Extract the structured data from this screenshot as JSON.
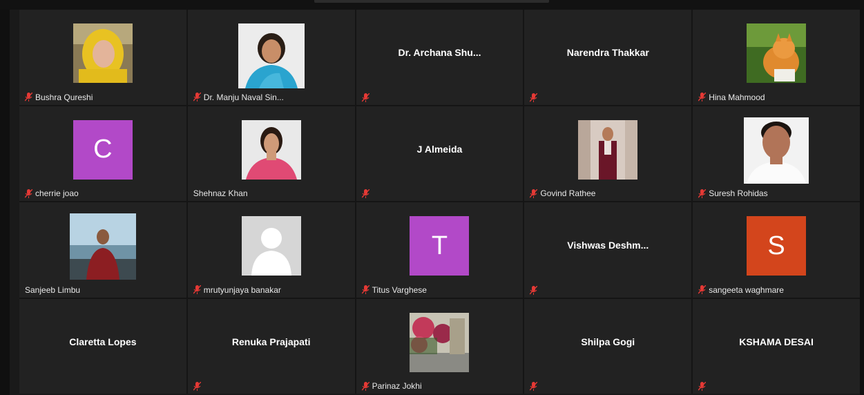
{
  "colors": {
    "background": "#1a1a1a",
    "tile": "#222222",
    "name_text": "#e9e9e9",
    "muted_icon": "#e53935",
    "avatar_purple": "#b249c8",
    "avatar_orange": "#d3451c"
  },
  "participants": [
    {
      "name": "Bushra Qureshi",
      "muted": true,
      "display": "photo"
    },
    {
      "name": "Dr. Manju Naval Sin...",
      "muted": true,
      "display": "photo"
    },
    {
      "name": "Dr. Archana Shu...",
      "muted": true,
      "display": "name"
    },
    {
      "name": "Narendra Thakkar",
      "muted": true,
      "display": "name"
    },
    {
      "name": "Hina Mahmood",
      "muted": true,
      "display": "photo"
    },
    {
      "name": "cherrie joao",
      "muted": true,
      "display": "avatar",
      "initial": "C",
      "avatar_color": "#b249c8"
    },
    {
      "name": "Shehnaz Khan",
      "muted": false,
      "display": "photo"
    },
    {
      "name": "J Almeida",
      "muted": true,
      "display": "name"
    },
    {
      "name": "Govind Rathee",
      "muted": true,
      "display": "photo"
    },
    {
      "name": "Suresh Rohidas",
      "muted": true,
      "display": "photo"
    },
    {
      "name": "Sanjeeb Limbu",
      "muted": false,
      "display": "photo"
    },
    {
      "name": "mrutyunjaya banakar",
      "muted": true,
      "display": "photo"
    },
    {
      "name": "Titus Varghese",
      "muted": true,
      "display": "avatar",
      "initial": "T",
      "avatar_color": "#b249c8"
    },
    {
      "name": "Vishwas Deshm...",
      "muted": true,
      "display": "name"
    },
    {
      "name": "sangeeta waghmare",
      "muted": true,
      "display": "avatar",
      "initial": "S",
      "avatar_color": "#d3451c"
    },
    {
      "name": "Claretta Lopes",
      "muted": false,
      "display": "name"
    },
    {
      "name": "Renuka Prajapati",
      "muted": true,
      "display": "name"
    },
    {
      "name": "Parinaz Jokhi",
      "muted": true,
      "display": "photo"
    },
    {
      "name": "Shilpa Gogi",
      "muted": true,
      "display": "name"
    },
    {
      "name": "KSHAMA DESAI",
      "muted": true,
      "display": "name"
    }
  ]
}
